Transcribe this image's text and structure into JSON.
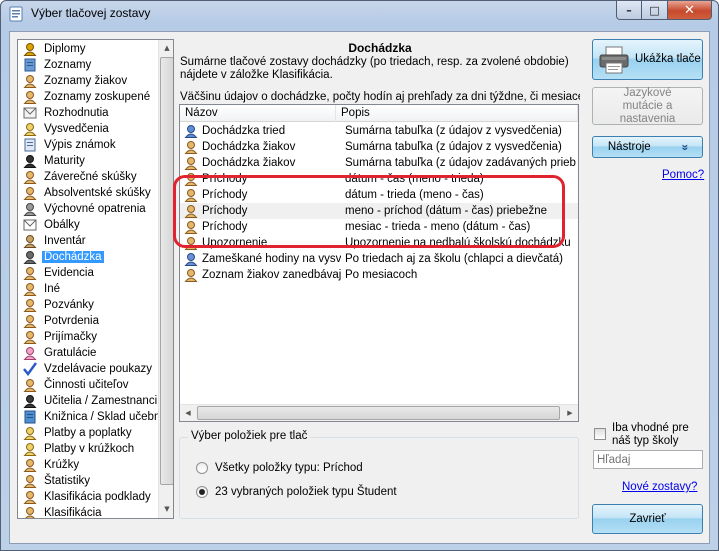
{
  "window": {
    "title": "Výber tlačovej zostavy",
    "close_glyph": "✕",
    "max_glyph": "□",
    "min_glyph": "–"
  },
  "tree": {
    "items": [
      {
        "label": "Diplomy",
        "icon": "award-icon"
      },
      {
        "label": "Zoznamy",
        "icon": "list-icon"
      },
      {
        "label": "Zoznamy žiakov",
        "icon": "students-icon"
      },
      {
        "label": "Zoznamy zoskupené",
        "icon": "students-icon"
      },
      {
        "label": "Rozhodnutia",
        "icon": "document-icon"
      },
      {
        "label": "Vysvedčenia",
        "icon": "certificate-icon"
      },
      {
        "label": "Výpis známok",
        "icon": "grades-icon"
      },
      {
        "label": "Maturity",
        "icon": "graduation-cap-icon"
      },
      {
        "label": "Záverečné skúšky",
        "icon": "exam-icon"
      },
      {
        "label": "Absolventské skúšky",
        "icon": "exam-icon"
      },
      {
        "label": "Výchovné opatrenia",
        "icon": "discipline-icon"
      },
      {
        "label": "Obálky",
        "icon": "envelope-icon"
      },
      {
        "label": "Inventár",
        "icon": "inventory-icon"
      },
      {
        "label": "Dochádzka",
        "icon": "attendance-icon"
      },
      {
        "label": "Evidencia",
        "icon": "records-icon"
      },
      {
        "label": "Iné",
        "icon": "other-icon"
      },
      {
        "label": "Pozvánky",
        "icon": "invitation-icon"
      },
      {
        "label": "Potvrdenia",
        "icon": "confirmation-icon"
      },
      {
        "label": "Prijímačky",
        "icon": "admission-icon"
      },
      {
        "label": "Gratulácie",
        "icon": "cake-icon"
      },
      {
        "label": "Vzdelávacie poukazy",
        "icon": "checkmark-icon"
      },
      {
        "label": "Činnosti učiteľov",
        "icon": "teacher-activity-icon"
      },
      {
        "label": "Učitelia / Zamestnanci",
        "icon": "teachers-icon"
      },
      {
        "label": "Knižnica / Sklad učebníc",
        "icon": "books-icon"
      },
      {
        "label": "Platby a poplatky",
        "icon": "payments-icon"
      },
      {
        "label": "Platby v krúžkoch",
        "icon": "payments-icon"
      },
      {
        "label": "Krúžky",
        "icon": "clubs-icon"
      },
      {
        "label": "Štatistiky",
        "icon": "statistics-icon"
      },
      {
        "label": "Klasifikácia podklady",
        "icon": "classification-icon"
      },
      {
        "label": "Klasifikácia",
        "icon": "classification-icon"
      }
    ],
    "selected": "Dochádzka"
  },
  "content": {
    "title": "Dochádzka",
    "description": "Sumárne tlačové zostavy dochádzky (po triedach, resp. za zvolené obdobie) nájdete v záložke Klasifikácia.",
    "hint": "Väčšinu údajov o dochádzke, počty hodín aj prehľady za dni týždne, či mesiace"
  },
  "list": {
    "columns": [
      "Názov",
      "Popis"
    ],
    "rows": [
      {
        "name": "Dochádzka tried",
        "desc": "Sumárna tabuľka (z údajov z vysvedčenia)",
        "icon": "group-icon"
      },
      {
        "name": "Dochádzka žiakov",
        "desc": "Sumárna tabuľka (z údajov z vysvedčenia)",
        "icon": "student-icon"
      },
      {
        "name": "Dochádzka žiakov",
        "desc": "Sumárna tabuľka (z údajov zadávaných priebežne)",
        "icon": "student-icon"
      },
      {
        "name": "Príchody",
        "desc": "dátum - čas (meno - trieda)",
        "icon": "student-icon"
      },
      {
        "name": "Príchody",
        "desc": "dátum - trieda (meno - čas)",
        "icon": "student-icon"
      },
      {
        "name": "Príchody",
        "desc": "meno - príchod (dátum - čas) priebežne",
        "icon": "student-icon"
      },
      {
        "name": "Príchody",
        "desc": "mesiac - trieda - meno (dátum - čas)",
        "icon": "student-icon"
      },
      {
        "name": "Upozornenie",
        "desc": "Upozornenie na nedbalú školskú dochádzku",
        "icon": "student-icon"
      },
      {
        "name": "Zameškané hodiny na vysvedčení",
        "desc": "Po triedach aj za školu (chlapci a dievčatá)",
        "icon": "edit-icon"
      },
      {
        "name": "Zoznam žiakov zanedbávajúcich",
        "desc": "Po mesiacoch",
        "icon": "student-icon"
      }
    ],
    "highlighted_rows": [
      "Príchody"
    ]
  },
  "selection": {
    "title": "Výber položiek pre tlač",
    "options": [
      {
        "label": "Všetky položky typu: Príchod",
        "checked": false
      },
      {
        "label": "23 vybraných položiek typu Študent",
        "checked": true
      }
    ]
  },
  "actions": {
    "preview_label": "Ukážka tlače",
    "language_label": "Jazykové mutácie a nastavenia",
    "tools_label": "Nástroje",
    "tools_glyph": "»",
    "help_link": "Pomoc?",
    "only_suitable_label": "Iba vhodné pre náš typ školy",
    "search_placeholder": "Hľadaj",
    "new_reports_link": "Nové zostavy?",
    "close_label": "Zavrieť"
  }
}
